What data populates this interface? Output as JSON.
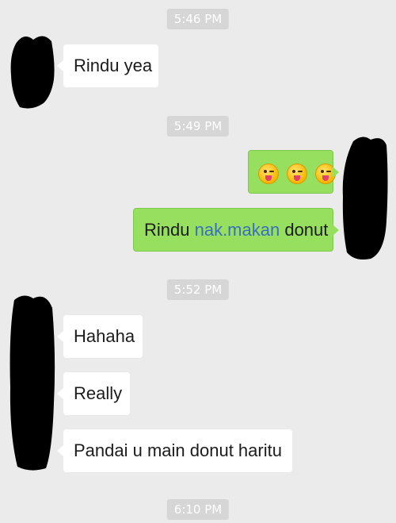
{
  "timestamps": [
    "5:46 PM",
    "5:49 PM",
    "5:52 PM",
    "6:10 PM"
  ],
  "messages": {
    "m1": "Rindu yea",
    "m3_part1": "Rindu ",
    "m3_link": "nak.makan",
    "m3_part2": " donut",
    "m4": "Hahaha",
    "m5": "Really",
    "m6": "Pandai u main donut haritu"
  },
  "emoji_message": [
    "winking-tongue-face-icon",
    "winking-tongue-face-icon",
    "winking-tongue-face-icon"
  ],
  "colors": {
    "outgoing": "#97e05f",
    "incoming": "#ffffff",
    "background": "#ebebeb",
    "link": "#3a6fbf"
  }
}
